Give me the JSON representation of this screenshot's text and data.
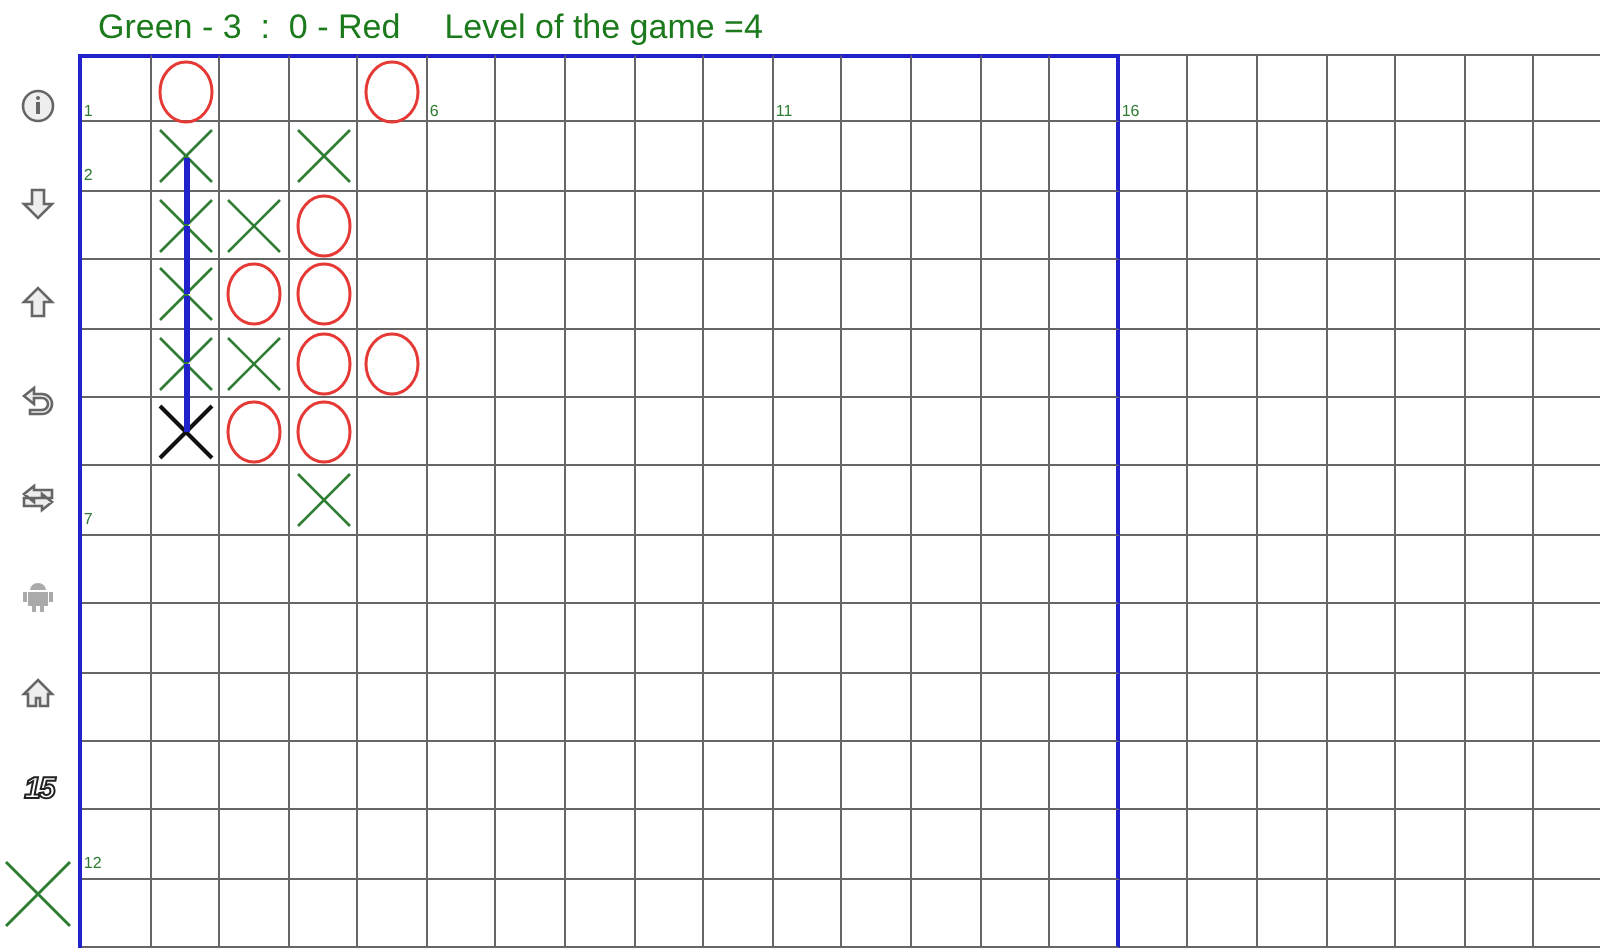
{
  "header": {
    "score": "Green - 3  :  0 - Red",
    "level": "Level of the game =4"
  },
  "sidebar": {
    "size_label": "15",
    "current_player": {
      "kind": "cross"
    }
  },
  "board": {
    "rows": [
      {
        "cells": [
          {
            "kind": "empty",
            "in_line": false
          },
          {
            "kind": "ring",
            "in_line": false
          },
          {
            "kind": "empty",
            "in_line": false
          },
          {
            "kind": "empty",
            "in_line": false
          },
          {
            "kind": "ring",
            "in_line": false
          },
          {
            "kind": "empty",
            "in_line": false
          },
          {
            "kind": "empty",
            "in_line": false
          },
          {
            "kind": "empty",
            "in_line": false
          },
          {
            "kind": "empty",
            "in_line": false
          },
          {
            "kind": "empty",
            "in_line": false
          },
          {
            "kind": "empty",
            "in_line": false
          },
          {
            "kind": "empty",
            "in_line": false
          },
          {
            "kind": "empty",
            "in_line": false
          },
          {
            "kind": "empty",
            "in_line": false
          },
          {
            "kind": "empty",
            "in_line": false
          },
          {
            "kind": "empty",
            "in_line": false
          },
          {
            "kind": "empty",
            "in_line": false
          },
          {
            "kind": "empty",
            "in_line": false
          },
          {
            "kind": "empty",
            "in_line": false
          },
          {
            "kind": "empty",
            "in_line": false
          },
          {
            "kind": "empty",
            "in_line": false
          },
          {
            "kind": "empty",
            "in_line": false
          }
        ]
      },
      {
        "cells": [
          {
            "kind": "empty",
            "in_line": false
          },
          {
            "kind": "cross",
            "in_line": true
          },
          {
            "kind": "empty",
            "in_line": false
          },
          {
            "kind": "cross",
            "in_line": false
          },
          {
            "kind": "empty",
            "in_line": false
          },
          {
            "kind": "empty",
            "in_line": false
          },
          {
            "kind": "empty",
            "in_line": false
          },
          {
            "kind": "empty",
            "in_line": false
          },
          {
            "kind": "empty",
            "in_line": false
          },
          {
            "kind": "empty",
            "in_line": false
          },
          {
            "kind": "empty",
            "in_line": false
          },
          {
            "kind": "empty",
            "in_line": false
          },
          {
            "kind": "empty",
            "in_line": false
          },
          {
            "kind": "empty",
            "in_line": false
          },
          {
            "kind": "empty",
            "in_line": false
          },
          {
            "kind": "empty",
            "in_line": false
          },
          {
            "kind": "empty",
            "in_line": false
          },
          {
            "kind": "empty",
            "in_line": false
          },
          {
            "kind": "empty",
            "in_line": false
          },
          {
            "kind": "empty",
            "in_line": false
          },
          {
            "kind": "empty",
            "in_line": false
          },
          {
            "kind": "empty",
            "in_line": false
          }
        ]
      },
      {
        "cells": [
          {
            "kind": "empty",
            "in_line": false
          },
          {
            "kind": "cross",
            "in_line": true
          },
          {
            "kind": "cross",
            "in_line": false
          },
          {
            "kind": "ring",
            "in_line": false
          },
          {
            "kind": "empty",
            "in_line": false
          },
          {
            "kind": "empty",
            "in_line": false
          },
          {
            "kind": "empty",
            "in_line": false
          },
          {
            "kind": "empty",
            "in_line": false
          },
          {
            "kind": "empty",
            "in_line": false
          },
          {
            "kind": "empty",
            "in_line": false
          },
          {
            "kind": "empty",
            "in_line": false
          },
          {
            "kind": "empty",
            "in_line": false
          },
          {
            "kind": "empty",
            "in_line": false
          },
          {
            "kind": "empty",
            "in_line": false
          },
          {
            "kind": "empty",
            "in_line": false
          },
          {
            "kind": "empty",
            "in_line": false
          },
          {
            "kind": "empty",
            "in_line": false
          },
          {
            "kind": "empty",
            "in_line": false
          },
          {
            "kind": "empty",
            "in_line": false
          },
          {
            "kind": "empty",
            "in_line": false
          },
          {
            "kind": "empty",
            "in_line": false
          },
          {
            "kind": "empty",
            "in_line": false
          }
        ]
      },
      {
        "cells": [
          {
            "kind": "empty",
            "in_line": false
          },
          {
            "kind": "cross",
            "in_line": true
          },
          {
            "kind": "ring",
            "in_line": false
          },
          {
            "kind": "ring",
            "in_line": false
          },
          {
            "kind": "empty",
            "in_line": false
          },
          {
            "kind": "empty",
            "in_line": false
          },
          {
            "kind": "empty",
            "in_line": false
          },
          {
            "kind": "empty",
            "in_line": false
          },
          {
            "kind": "empty",
            "in_line": false
          },
          {
            "kind": "empty",
            "in_line": false
          },
          {
            "kind": "empty",
            "in_line": false
          },
          {
            "kind": "empty",
            "in_line": false
          },
          {
            "kind": "empty",
            "in_line": false
          },
          {
            "kind": "empty",
            "in_line": false
          },
          {
            "kind": "empty",
            "in_line": false
          },
          {
            "kind": "empty",
            "in_line": false
          },
          {
            "kind": "empty",
            "in_line": false
          },
          {
            "kind": "empty",
            "in_line": false
          },
          {
            "kind": "empty",
            "in_line": false
          },
          {
            "kind": "empty",
            "in_line": false
          },
          {
            "kind": "empty",
            "in_line": false
          },
          {
            "kind": "empty",
            "in_line": false
          }
        ]
      },
      {
        "cells": [
          {
            "kind": "empty",
            "in_line": false
          },
          {
            "kind": "cross",
            "in_line": true
          },
          {
            "kind": "cross",
            "in_line": false
          },
          {
            "kind": "ring",
            "in_line": false
          },
          {
            "kind": "ring",
            "in_line": false
          },
          {
            "kind": "empty",
            "in_line": false
          },
          {
            "kind": "empty",
            "in_line": false
          },
          {
            "kind": "empty",
            "in_line": false
          },
          {
            "kind": "empty",
            "in_line": false
          },
          {
            "kind": "empty",
            "in_line": false
          },
          {
            "kind": "empty",
            "in_line": false
          },
          {
            "kind": "empty",
            "in_line": false
          },
          {
            "kind": "empty",
            "in_line": false
          },
          {
            "kind": "empty",
            "in_line": false
          },
          {
            "kind": "empty",
            "in_line": false
          },
          {
            "kind": "empty",
            "in_line": false
          },
          {
            "kind": "empty",
            "in_line": false
          },
          {
            "kind": "empty",
            "in_line": false
          },
          {
            "kind": "empty",
            "in_line": false
          },
          {
            "kind": "empty",
            "in_line": false
          },
          {
            "kind": "empty",
            "in_line": false
          },
          {
            "kind": "empty",
            "in_line": false
          }
        ]
      },
      {
        "cells": [
          {
            "kind": "empty",
            "in_line": false
          },
          {
            "kind": "lastcross",
            "in_line": true
          },
          {
            "kind": "ring",
            "in_line": false
          },
          {
            "kind": "ring",
            "in_line": false
          },
          {
            "kind": "empty",
            "in_line": false
          },
          {
            "kind": "empty",
            "in_line": false
          },
          {
            "kind": "empty",
            "in_line": false
          },
          {
            "kind": "empty",
            "in_line": false
          },
          {
            "kind": "empty",
            "in_line": false
          },
          {
            "kind": "empty",
            "in_line": false
          },
          {
            "kind": "empty",
            "in_line": false
          },
          {
            "kind": "empty",
            "in_line": false
          },
          {
            "kind": "empty",
            "in_line": false
          },
          {
            "kind": "empty",
            "in_line": false
          },
          {
            "kind": "empty",
            "in_line": false
          },
          {
            "kind": "empty",
            "in_line": false
          },
          {
            "kind": "empty",
            "in_line": false
          },
          {
            "kind": "empty",
            "in_line": false
          },
          {
            "kind": "empty",
            "in_line": false
          },
          {
            "kind": "empty",
            "in_line": false
          },
          {
            "kind": "empty",
            "in_line": false
          },
          {
            "kind": "empty",
            "in_line": false
          }
        ]
      },
      {
        "cells": [
          {
            "kind": "empty",
            "in_line": false
          },
          {
            "kind": "empty",
            "in_line": false
          },
          {
            "kind": "empty",
            "in_line": false
          },
          {
            "kind": "cross",
            "in_line": false
          },
          {
            "kind": "empty",
            "in_line": false
          },
          {
            "kind": "empty",
            "in_line": false
          },
          {
            "kind": "empty",
            "in_line": false
          },
          {
            "kind": "empty",
            "in_line": false
          },
          {
            "kind": "empty",
            "in_line": false
          },
          {
            "kind": "empty",
            "in_line": false
          },
          {
            "kind": "empty",
            "in_line": false
          },
          {
            "kind": "empty",
            "in_line": false
          },
          {
            "kind": "empty",
            "in_line": false
          },
          {
            "kind": "empty",
            "in_line": false
          },
          {
            "kind": "empty",
            "in_line": false
          },
          {
            "kind": "empty",
            "in_line": false
          },
          {
            "kind": "empty",
            "in_line": false
          },
          {
            "kind": "empty",
            "in_line": false
          },
          {
            "kind": "empty",
            "in_line": false
          },
          {
            "kind": "empty",
            "in_line": false
          },
          {
            "kind": "empty",
            "in_line": false
          },
          {
            "kind": "empty",
            "in_line": false
          }
        ]
      },
      {
        "cells": [
          {
            "kind": "empty",
            "in_line": false
          },
          {
            "kind": "empty",
            "in_line": false
          },
          {
            "kind": "empty",
            "in_line": false
          },
          {
            "kind": "empty",
            "in_line": false
          },
          {
            "kind": "empty",
            "in_line": false
          },
          {
            "kind": "empty",
            "in_line": false
          },
          {
            "kind": "empty",
            "in_line": false
          },
          {
            "kind": "empty",
            "in_line": false
          },
          {
            "kind": "empty",
            "in_line": false
          },
          {
            "kind": "empty",
            "in_line": false
          },
          {
            "kind": "empty",
            "in_line": false
          },
          {
            "kind": "empty",
            "in_line": false
          },
          {
            "kind": "empty",
            "in_line": false
          },
          {
            "kind": "empty",
            "in_line": false
          },
          {
            "kind": "empty",
            "in_line": false
          },
          {
            "kind": "empty",
            "in_line": false
          },
          {
            "kind": "empty",
            "in_line": false
          },
          {
            "kind": "empty",
            "in_line": false
          },
          {
            "kind": "empty",
            "in_line": false
          },
          {
            "kind": "empty",
            "in_line": false
          },
          {
            "kind": "empty",
            "in_line": false
          },
          {
            "kind": "empty",
            "in_line": false
          }
        ]
      },
      {
        "cells": [
          {
            "kind": "empty",
            "in_line": false
          },
          {
            "kind": "empty",
            "in_line": false
          },
          {
            "kind": "empty",
            "in_line": false
          },
          {
            "kind": "empty",
            "in_line": false
          },
          {
            "kind": "empty",
            "in_line": false
          },
          {
            "kind": "empty",
            "in_line": false
          },
          {
            "kind": "empty",
            "in_line": false
          },
          {
            "kind": "empty",
            "in_line": false
          },
          {
            "kind": "empty",
            "in_line": false
          },
          {
            "kind": "empty",
            "in_line": false
          },
          {
            "kind": "empty",
            "in_line": false
          },
          {
            "kind": "empty",
            "in_line": false
          },
          {
            "kind": "empty",
            "in_line": false
          },
          {
            "kind": "empty",
            "in_line": false
          },
          {
            "kind": "empty",
            "in_line": false
          },
          {
            "kind": "empty",
            "in_line": false
          },
          {
            "kind": "empty",
            "in_line": false
          },
          {
            "kind": "empty",
            "in_line": false
          },
          {
            "kind": "empty",
            "in_line": false
          },
          {
            "kind": "empty",
            "in_line": false
          },
          {
            "kind": "empty",
            "in_line": false
          },
          {
            "kind": "empty",
            "in_line": false
          }
        ]
      },
      {
        "cells": [
          {
            "kind": "empty",
            "in_line": false
          },
          {
            "kind": "empty",
            "in_line": false
          },
          {
            "kind": "empty",
            "in_line": false
          },
          {
            "kind": "empty",
            "in_line": false
          },
          {
            "kind": "empty",
            "in_line": false
          },
          {
            "kind": "empty",
            "in_line": false
          },
          {
            "kind": "empty",
            "in_line": false
          },
          {
            "kind": "empty",
            "in_line": false
          },
          {
            "kind": "empty",
            "in_line": false
          },
          {
            "kind": "empty",
            "in_line": false
          },
          {
            "kind": "empty",
            "in_line": false
          },
          {
            "kind": "empty",
            "in_line": false
          },
          {
            "kind": "empty",
            "in_line": false
          },
          {
            "kind": "empty",
            "in_line": false
          },
          {
            "kind": "empty",
            "in_line": false
          },
          {
            "kind": "empty",
            "in_line": false
          },
          {
            "kind": "empty",
            "in_line": false
          },
          {
            "kind": "empty",
            "in_line": false
          },
          {
            "kind": "empty",
            "in_line": false
          },
          {
            "kind": "empty",
            "in_line": false
          },
          {
            "kind": "empty",
            "in_line": false
          },
          {
            "kind": "empty",
            "in_line": false
          }
        ]
      },
      {
        "cells": [
          {
            "kind": "empty",
            "in_line": false
          },
          {
            "kind": "empty",
            "in_line": false
          },
          {
            "kind": "empty",
            "in_line": false
          },
          {
            "kind": "empty",
            "in_line": false
          },
          {
            "kind": "empty",
            "in_line": false
          },
          {
            "kind": "empty",
            "in_line": false
          },
          {
            "kind": "empty",
            "in_line": false
          },
          {
            "kind": "empty",
            "in_line": false
          },
          {
            "kind": "empty",
            "in_line": false
          },
          {
            "kind": "empty",
            "in_line": false
          },
          {
            "kind": "empty",
            "in_line": false
          },
          {
            "kind": "empty",
            "in_line": false
          },
          {
            "kind": "empty",
            "in_line": false
          },
          {
            "kind": "empty",
            "in_line": false
          },
          {
            "kind": "empty",
            "in_line": false
          },
          {
            "kind": "empty",
            "in_line": false
          },
          {
            "kind": "empty",
            "in_line": false
          },
          {
            "kind": "empty",
            "in_line": false
          },
          {
            "kind": "empty",
            "in_line": false
          },
          {
            "kind": "empty",
            "in_line": false
          },
          {
            "kind": "empty",
            "in_line": false
          },
          {
            "kind": "empty",
            "in_line": false
          }
        ]
      },
      {
        "cells": [
          {
            "kind": "empty",
            "in_line": false
          },
          {
            "kind": "empty",
            "in_line": false
          },
          {
            "kind": "empty",
            "in_line": false
          },
          {
            "kind": "empty",
            "in_line": false
          },
          {
            "kind": "empty",
            "in_line": false
          },
          {
            "kind": "empty",
            "in_line": false
          },
          {
            "kind": "empty",
            "in_line": false
          },
          {
            "kind": "empty",
            "in_line": false
          },
          {
            "kind": "empty",
            "in_line": false
          },
          {
            "kind": "empty",
            "in_line": false
          },
          {
            "kind": "empty",
            "in_line": false
          },
          {
            "kind": "empty",
            "in_line": false
          },
          {
            "kind": "empty",
            "in_line": false
          },
          {
            "kind": "empty",
            "in_line": false
          },
          {
            "kind": "empty",
            "in_line": false
          },
          {
            "kind": "empty",
            "in_line": false
          },
          {
            "kind": "empty",
            "in_line": false
          },
          {
            "kind": "empty",
            "in_line": false
          },
          {
            "kind": "empty",
            "in_line": false
          },
          {
            "kind": "empty",
            "in_line": false
          },
          {
            "kind": "empty",
            "in_line": false
          },
          {
            "kind": "empty",
            "in_line": false
          }
        ]
      },
      {
        "cells": [
          {
            "kind": "empty",
            "in_line": false
          },
          {
            "kind": "empty",
            "in_line": false
          },
          {
            "kind": "empty",
            "in_line": false
          },
          {
            "kind": "empty",
            "in_line": false
          },
          {
            "kind": "empty",
            "in_line": false
          },
          {
            "kind": "empty",
            "in_line": false
          },
          {
            "kind": "empty",
            "in_line": false
          },
          {
            "kind": "empty",
            "in_line": false
          },
          {
            "kind": "empty",
            "in_line": false
          },
          {
            "kind": "empty",
            "in_line": false
          },
          {
            "kind": "empty",
            "in_line": false
          },
          {
            "kind": "empty",
            "in_line": false
          },
          {
            "kind": "empty",
            "in_line": false
          },
          {
            "kind": "empty",
            "in_line": false
          },
          {
            "kind": "empty",
            "in_line": false
          },
          {
            "kind": "empty",
            "in_line": false
          },
          {
            "kind": "empty",
            "in_line": false
          },
          {
            "kind": "empty",
            "in_line": false
          },
          {
            "kind": "empty",
            "in_line": false
          },
          {
            "kind": "empty",
            "in_line": false
          },
          {
            "kind": "empty",
            "in_line": false
          },
          {
            "kind": "empty",
            "in_line": false
          }
        ]
      }
    ],
    "column_labels": [
      "1",
      "6",
      "11",
      "16"
    ],
    "row_labels": [
      "2",
      "7",
      "12"
    ]
  }
}
